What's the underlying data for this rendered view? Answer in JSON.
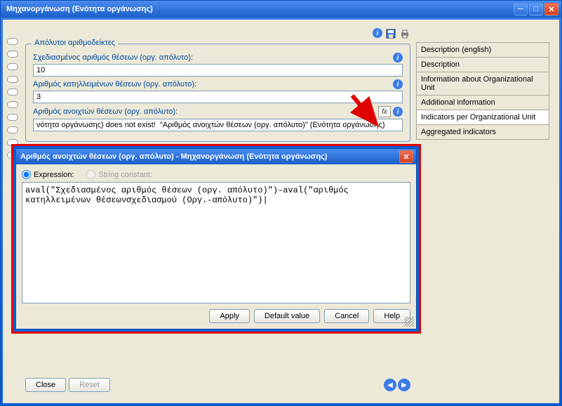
{
  "window": {
    "title": "Μηχανοργάνωση (Ενότητα οργάνωσης)"
  },
  "fieldset_title": "Απόλυτοι αριθμοδείκτες",
  "fields": {
    "planned": {
      "label": "Σχεδιασμένος αριθμός θέσεων (οργ. απόλυτο):",
      "value": "10"
    },
    "occupied": {
      "label": "Αριθμός κατηλλειμένων θέσεων (οργ. απόλυτο):",
      "value": "3"
    },
    "open": {
      "label": "Αριθμός ανοιχτών θέσεων (οργ. απόλυτο):",
      "value": "νότητα οργάνωσης) does not exist!  \"Αριθμός ανοιχτών θέσεων (οργ. απόλυτο)\" (Ενότητα οργάνωσης)"
    }
  },
  "tabs": {
    "t0": "Description (english)",
    "t1": "Description",
    "t2": "Information about Organizational Unit",
    "t3": "Additional information",
    "t4": "Indicators per Organizational Unit",
    "t5": "Aggregated indicators"
  },
  "footer": {
    "close": "Close",
    "reset": "Reset"
  },
  "dialog": {
    "title": "Αριθμός ανοιχτών θέσεων (οργ. απόλυτο) - Μηχανοργάνωση (Ενότητα οργάνωσης)",
    "expr_label": "Expression:",
    "str_label": "String constant:",
    "text": "aval(\"Σχεδιασμένος αριθμός θέσεων (οργ. απόλυτο)\")-aval(\"αριθμός κατηλλειμένων θέσεωνσχεδιασμού (Οργ.-απόλυτο)\")|",
    "btns": {
      "apply": "Apply",
      "default": "Default value",
      "cancel": "Cancel",
      "help": "Help"
    }
  }
}
